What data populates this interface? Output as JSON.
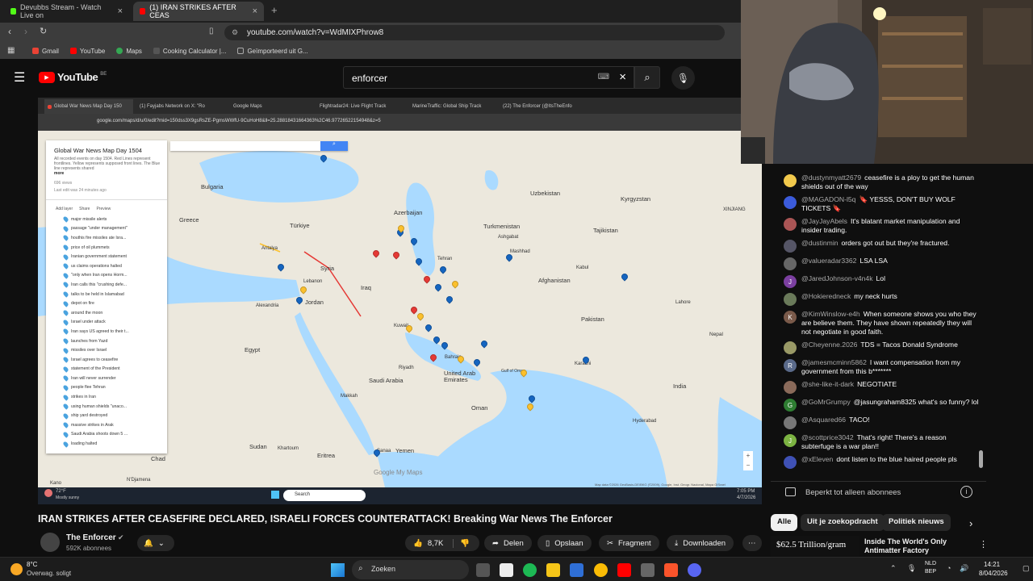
{
  "browser": {
    "tabs": [
      {
        "label": "Devubbs Stream - Watch Live on",
        "active": false,
        "color": "#53fc18"
      },
      {
        "label": "(1) IRAN STRIKES AFTER CEAS",
        "active": true,
        "color": "#ff0000"
      }
    ],
    "url": "youtube.com/watch?v=WdMIXPhrow8",
    "bookmarks": [
      {
        "label": "Gmail",
        "color": "#ea4335"
      },
      {
        "label": "YouTube",
        "color": "#ff0000"
      },
      {
        "label": "Maps",
        "color": "#34a853"
      },
      {
        "label": "Cooking Calculator |...",
        "color": "#555"
      },
      {
        "label": "Geïmporteerd uit G...",
        "color": "#777"
      }
    ]
  },
  "youtube": {
    "logo": "YouTube",
    "region": "BE",
    "search_value": "enforcer"
  },
  "video": {
    "inner_tabs": [
      "Global War News Map Day 150",
      "(1) Fayjabs Network on X: \"Ro",
      "Google Maps",
      "Flightradar24: Live Flight Track",
      "MarineTraffic: Global Ship Track",
      "(22) The Enforcer (@ItsTheEnfo"
    ],
    "inner_url": "google.com/maps/d/u/0/edit?mid=150dss3X9gsRsZE-PgmsWWfU-9CuHoH8&ll=25.28818431664363%2C46.97726522154948&z=5",
    "panel": {
      "title": "Global War News Map Day 1504",
      "description": "All recorded events on day 1504. Red Lines represent frontlines. Yellow represents supposed front lines. The Blue line represents shared",
      "more": "more",
      "views": "696 views",
      "last_edit": "Last edit was 24 minutes ago",
      "actions": [
        "Add layer",
        "Share",
        "Preview"
      ],
      "layers": [
        "major missile alerts",
        "passage \"under management\"",
        "houthis fire missiles ate Isra...",
        "price of oil plummets",
        "Iranian government statement",
        "us claims operations halted",
        "\"only when Iran opens Horm...",
        "Iran calls this \"crushing defe...",
        "talks to be held in Islamabad",
        "depot on fire",
        "around the moon",
        "Israel under attack",
        "Iran says US agreed to their t...",
        "launches from Yazd",
        "missiles over Israel",
        "Israel agrees to ceasefire",
        "statement of the President",
        "Iran will never surrender",
        "people flee Tehran",
        "strikes in Iran",
        "using human shields \"unaco...",
        "ship yard destroyed",
        "massive strikes in Arak",
        "Saudi Arabia shoots down 5 ...",
        "loading halted"
      ]
    },
    "map_labels": [
      "Bulgaria",
      "Greece",
      "Türkiye",
      "Azerbaijan",
      "Uzbekistan",
      "Kyrgyzstan",
      "Turkmenistan",
      "Ashgabat",
      "Tajikistan",
      "Mashhad",
      "Tehran",
      "Antalya",
      "Syria",
      "Lebanon",
      "Iraq",
      "Afghanistan",
      "Kabul",
      "Alexandria",
      "Jordan",
      "Pakistan",
      "Egypt",
      "Kuwait",
      "Bahrain",
      "Riyadh",
      "Saudi Arabia",
      "United Arab Emirates",
      "Karachi",
      "Nepal",
      "India",
      "Makkah",
      "Oman",
      "Sudan",
      "Khartoum",
      "Eritrea",
      "Sanaa",
      "Yemen",
      "Chad",
      "N'Djamena",
      "Kano",
      "XINJIANG",
      "Lahore",
      "Gulf of Oman",
      "Hyderabad"
    ],
    "map_footer": "Map data ©2026 GeoBasis-DE/BKG (©2009), Google, Inst. Geogr. Nacional, Mapa GISrael",
    "google_logo": "Google My Maps",
    "inner_taskbar": {
      "weather": "72°F",
      "weather_sub": "Mostly sunny",
      "search": "Search",
      "time": "7:05 PM",
      "date": "4/7/2026"
    }
  },
  "title": "IRAN STRIKES AFTER CEASEFIRE DECLARED, ISRAELI FORCES COUNTERATTACK! Breaking War News The Enforcer",
  "channel": {
    "name": "The Enforcer",
    "subs": "592K abonnees"
  },
  "actions": {
    "likes": "8,7K",
    "share": "Delen",
    "save": "Opslaan",
    "clip": "Fragment",
    "download": "Downloaden"
  },
  "chat": {
    "messages": [
      {
        "author": "@dustynmyatt2679",
        "text": "ceasefire is a ploy to get the human shields out of the way",
        "avatar_color": "#f2c94c",
        "initial": ""
      },
      {
        "author": "@MAGADON-l5q",
        "text": "🔖 YESSS, DON'T BUY WOLF TICKETS 🔖",
        "avatar_color": "#3b5bdb",
        "initial": ""
      },
      {
        "author": "@JayJayAbels",
        "text": "It's blatant market manipulation and insider trading.",
        "avatar_color": "#a55",
        "initial": ""
      },
      {
        "author": "@dustinmin",
        "text": "orders got out but they're fractured.",
        "avatar_color": "#556",
        "initial": ""
      },
      {
        "author": "@valueradar3362",
        "text": "LSA LSA",
        "avatar_color": "#666",
        "initial": ""
      },
      {
        "author": "@JaredJohnson-v4n4k",
        "text": "Lol",
        "avatar_color": "#7b3fa0",
        "initial": "J"
      },
      {
        "author": "@Hokieredneck",
        "text": "my neck hurts",
        "avatar_color": "#6a7a5a",
        "initial": ""
      },
      {
        "author": "@KimWinslow-e4h",
        "text": "When someone shows you who they are believe them. They have shown repeatedly they will not negotiate in good faith.",
        "avatar_color": "#7a5a4a",
        "initial": "K"
      },
      {
        "author": "@Cheyenne.2026",
        "text": "TDS = Tacos Donald Syndrome",
        "avatar_color": "#996",
        "initial": ""
      },
      {
        "author": "@jamesmcminn5862",
        "text": "I want compensation from my government from this b*******",
        "avatar_color": "#5a6a8a",
        "initial": "R"
      },
      {
        "author": "@she-like-it-dark",
        "text": "NEGOTIATE",
        "avatar_color": "#8a6a5a",
        "initial": ""
      },
      {
        "author": "@GoMrGrumpy",
        "text": "@jasungraham8325 what's so funny? lol",
        "avatar_color": "#2e7d32",
        "initial": "G"
      },
      {
        "author": "@Asquared66",
        "text": "TACO!",
        "avatar_color": "#777",
        "initial": ""
      },
      {
        "author": "@scottprice3042",
        "text": "That's right! There's a reason subterfuge is a war plan!!",
        "avatar_color": "#7cb342",
        "initial": "J"
      },
      {
        "author": "@xEleven",
        "text": "dont listen to the blue haired people pls",
        "avatar_color": "#3f51b5",
        "initial": ""
      }
    ],
    "footer": "Beperkt tot alleen abonnees"
  },
  "chips": [
    "Alle",
    "Uit je zoekopdracht",
    "Politiek nieuws"
  ],
  "recommended": {
    "thumb_text": "$62.5 Trillion/gram",
    "title": "Inside The World's Only Antimatter Factory"
  },
  "taskbar": {
    "weather_temp": "8°C",
    "weather_desc": "Overwag. soligt",
    "search": "Zoeken",
    "lang": "NLD",
    "lang2": "BEP",
    "time": "14:21",
    "date": "8/04/2026"
  }
}
